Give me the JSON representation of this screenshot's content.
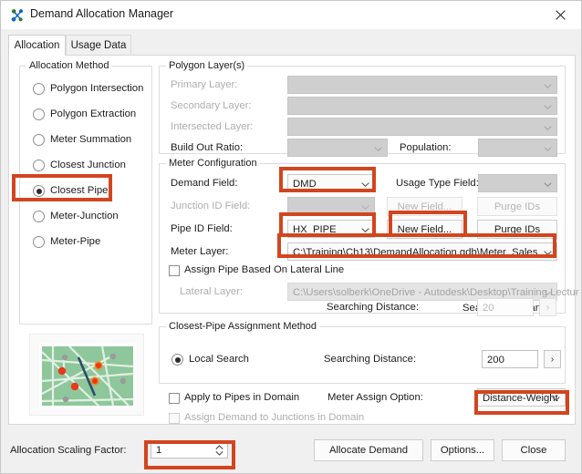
{
  "window": {
    "title": "Demand Allocation Manager",
    "icon": "demand-allocation-icon",
    "close_label": "✕"
  },
  "tabs": [
    {
      "label": "Allocation",
      "active": true
    },
    {
      "label": "Usage Data",
      "active": false
    }
  ],
  "allocation_method": {
    "group_title": "Allocation Method",
    "options": [
      {
        "label": "Polygon Intersection",
        "selected": false
      },
      {
        "label": "Polygon Extraction",
        "selected": false
      },
      {
        "label": "Meter Summation",
        "selected": false
      },
      {
        "label": "Closest Junction",
        "selected": false
      },
      {
        "label": "Closest Pipe",
        "selected": true
      },
      {
        "label": "Meter-Junction",
        "selected": false
      },
      {
        "label": "Meter-Pipe",
        "selected": false
      }
    ]
  },
  "polygon_layers": {
    "group_title": "Polygon Layer(s)",
    "primary_layer_label": "Primary Layer:",
    "primary_layer_value": "",
    "secondary_layer_label": "Secondary Layer:",
    "secondary_layer_value": "",
    "intersected_layer_label": "Intersected Layer:",
    "intersected_layer_value": "",
    "build_out_ratio_label": "Build Out Ratio:",
    "build_out_ratio_value": "",
    "population_label": "Population:",
    "population_value": ""
  },
  "meter_configuration": {
    "group_title": "Meter Configuration",
    "demand_field_label": "Demand Field:",
    "demand_field_value": "DMD",
    "usage_type_field_label": "Usage Type Field:",
    "usage_type_field_value": "",
    "junction_id_field_label": "Junction ID Field:",
    "junction_id_field_value": "",
    "junction_new_field_label": "New Field...",
    "junction_purge_ids_label": "Purge IDs",
    "pipe_id_field_label": "Pipe ID Field:",
    "pipe_id_field_value": "HX_PIPE",
    "pipe_new_field_label": "New Field...",
    "pipe_purge_ids_label": "Purge IDs",
    "meter_layer_label": "Meter Layer:",
    "meter_layer_value": "C:\\Training\\Ch13\\DemandAllocation.gdb\\Meter_Sales",
    "assign_pipe_lateral_label": "Assign Pipe Based On Lateral Line",
    "assign_pipe_lateral_checked": false,
    "lateral_layer_label": "Lateral Layer:",
    "lateral_layer_value": "C:\\Users\\solberk\\OneDrive - Autodesk\\Desktop\\Training Lectur",
    "searching_distance_label": "Searching Distance:",
    "searching_distance_value": "20",
    "searching_distance_button": "›"
  },
  "closest_pipe_method": {
    "group_title": "Closest-Pipe Assignment Method",
    "local_search_label": "Local Search",
    "local_search_selected": true,
    "searching_distance_label": "Searching Distance:",
    "searching_distance_value": "200",
    "searching_distance_button": "›"
  },
  "domain_options": {
    "apply_to_pipes_label": "Apply to Pipes in Domain",
    "apply_to_pipes_checked": false,
    "assign_demand_junctions_label": "Assign Demand to Junctions in Domain",
    "assign_demand_junctions_checked": false,
    "meter_assign_option_label": "Meter Assign Option:",
    "meter_assign_option_value": "Distance-Weight"
  },
  "footer": {
    "scaling_factor_label": "Allocation Scaling Factor:",
    "scaling_factor_value": "1",
    "allocate_demand_label": "Allocate Demand",
    "options_label": "Options...",
    "close_label": "Close"
  },
  "preview": {
    "name": "closest-pipe-preview-thumbnail",
    "background_color": "#8dc79b",
    "pipe_color": "#ffffff",
    "meter_color": "#e8391a",
    "junction_color": "#9a9a9a",
    "assignment_line_color": "#2c4d6e"
  },
  "colors": {
    "highlight": "#d2451e",
    "window_bg": "#f0f0f0",
    "panel_bg": "#ffffff"
  }
}
